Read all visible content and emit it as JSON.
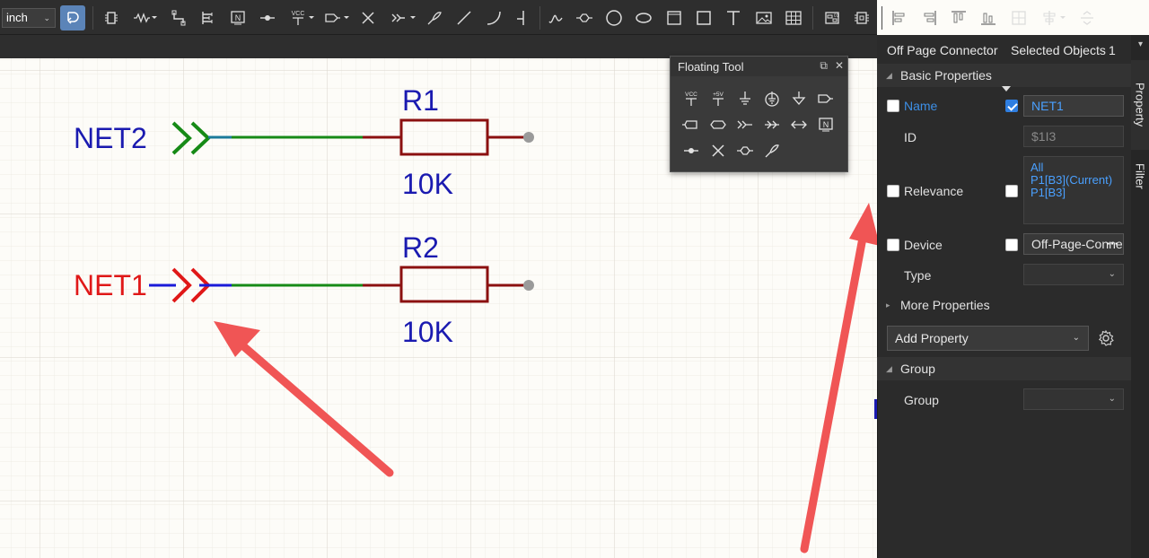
{
  "toolbar": {
    "unit": "inch",
    "tools": [
      "select-mode",
      "component",
      "wire-net",
      "net-label-port",
      "bus",
      "net-flag",
      "no-connect-mark",
      "vcc",
      "net-port",
      "no-connect",
      "off-page-connector",
      "probe",
      "line",
      "arc",
      "junction",
      "bezier",
      "bus-entry",
      "circle",
      "ellipse",
      "rectangle",
      "square",
      "text",
      "image",
      "table",
      "export-bom",
      "netlist",
      "align-left",
      "align-right",
      "align-top",
      "align-bottom",
      "distribute",
      "align-center"
    ]
  },
  "schematic": {
    "components": [
      {
        "designator": "R1",
        "value": "10K",
        "net_label": "NET2"
      },
      {
        "designator": "R2",
        "value": "10K",
        "net_label": "NET1"
      }
    ],
    "colors": {
      "net2_label": "#1a1ab0",
      "net1_label": "#e01818",
      "wire": "#168a16",
      "resistor": "#8b1010",
      "ref_text": "#1a1ab0",
      "annotation_arrow": "#f05555"
    }
  },
  "floating_tool": {
    "title": "Floating Tool",
    "items": [
      "vcc-power",
      "plus5v-power",
      "ground",
      "circle-ground",
      "arrow-ground",
      "net-port-out",
      "net-port-in",
      "net-port-bidir",
      "off-page-connector",
      "off-page-arrow",
      "net-port-both",
      "net-label",
      "no-connect-dot",
      "no-connect",
      "bus-entry",
      "probe"
    ],
    "vcc_text": "VCC",
    "plus5v_text": "+5V"
  },
  "panel": {
    "title": "Off Page Connector",
    "selected_label": "Selected Objects",
    "selected_count": "1",
    "basic_properties": "Basic Properties",
    "name_label": "Name",
    "name_value": "NET1",
    "id_label": "ID",
    "id_value": "$1I3",
    "relevance_label": "Relevance",
    "relevance_lines": [
      "All",
      "P1[B3](Current)",
      "P1[B3]"
    ],
    "device_label": "Device",
    "device_value": "Off-Page-Connector",
    "type_label": "Type",
    "type_value": "",
    "more_properties": "More Properties",
    "add_property": "Add Property",
    "group_section": "Group",
    "group_label": "Group",
    "group_value": ""
  },
  "tabs": {
    "property": "Property",
    "filter": "Filter"
  }
}
